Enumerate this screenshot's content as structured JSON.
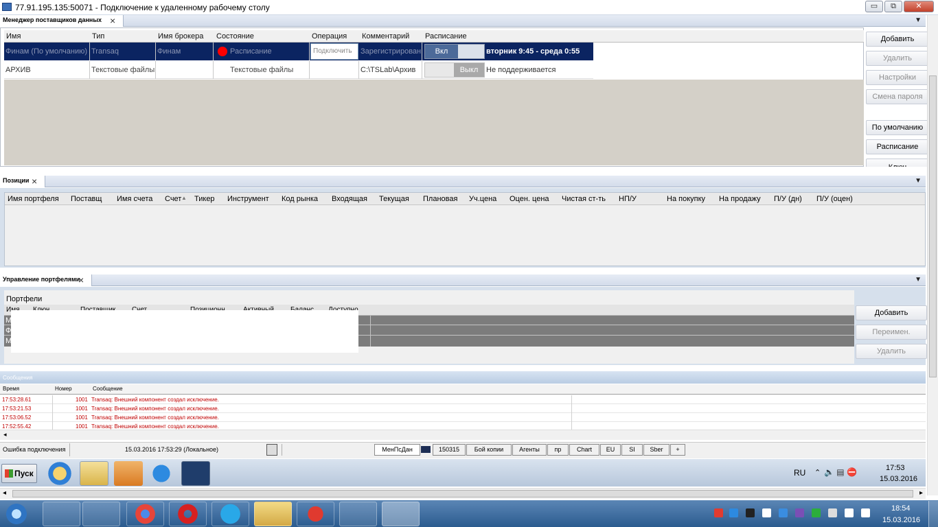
{
  "window": {
    "title": "77.91.195.135:50071 - Подключение к удаленному рабочему столу",
    "btn_min": "▭",
    "btn_restore": "⧉",
    "btn_close": "✕"
  },
  "providers": {
    "tab_label": "Менеджер поставщиков данных",
    "columns": [
      "Имя",
      "Тип",
      "Имя брокера",
      "Состояние",
      "Операция",
      "Комментарий",
      "Расписание"
    ],
    "rows": [
      {
        "name": "Финам (По умолчанию)",
        "type": "Transaq",
        "broker": "Финам",
        "state": "Расписание",
        "operation": "Подключить",
        "comment": "Зарегистрирован",
        "toggle": "Вкл",
        "schedule": "вторник 9:45 - среда 0:55"
      },
      {
        "name": "АРХИВ",
        "type": "Текстовые файлы",
        "broker": "",
        "state": "Текстовые файлы",
        "operation": "",
        "comment": "C:\\TSLab\\Архив",
        "toggle": "Выкл",
        "schedule": "Не поддерживается"
      }
    ],
    "buttons": [
      "Добавить",
      "Удалить",
      "Настройки",
      "Смена пароля",
      "По умолчанию",
      "Расписание",
      "Ключ"
    ]
  },
  "positions": {
    "tab_label": "Позиции",
    "columns": [
      "Имя портфеля",
      "Поставщ",
      "Имя счета",
      "Счет",
      "Тикер",
      "Инструмент",
      "Код рынка",
      "Входящая",
      "Текущая",
      "Плановая",
      "Уч.цена",
      "Оцен. цена",
      "Чистая ст-ть",
      "НП/У",
      "На покупку",
      "На продажу",
      "П/У (дн)",
      "П/У (оцен)"
    ]
  },
  "portfolios": {
    "tab_label": "Управление портфелями",
    "title": "Портфели",
    "columns": [
      "Имя",
      "Ключ",
      "Поставщик",
      "Счет",
      "Позиционн",
      "Активный",
      "Баланс",
      "Доступно"
    ],
    "row_initials": [
      "М",
      "Ф",
      "М"
    ],
    "buttons": [
      "Добавить",
      "Переимен.",
      "Удалить"
    ]
  },
  "messages": {
    "tab_label": "Сообщения",
    "columns": [
      "Время",
      "Номер",
      "Сообщение"
    ],
    "rows": [
      {
        "time": "17:53:28.61",
        "num": "1001",
        "msg": "Transaq: Внешний компонент создал исключение."
      },
      {
        "time": "17:53:21.53",
        "num": "1001",
        "msg": "Transaq: Внешний компонент создал исключение."
      },
      {
        "time": "17:53:06.52",
        "num": "1001",
        "msg": "Transaq: Внешний компонент создал исключение."
      },
      {
        "time": "17:52:55.42",
        "num": "1001",
        "msg": "Transaq: Внешний компонент создал исключение."
      }
    ]
  },
  "statusbar": {
    "status": "Ошибка подключения",
    "datetime": "15.03.2016 17:53:29 (Локальное)"
  },
  "workspace_tabs": [
    "МенПсДан",
    "150315",
    "Бой копии",
    "Агенты",
    "пр",
    "Chart",
    "EU",
    "SI",
    "Sber",
    "+"
  ],
  "remote_taskbar": {
    "start": "Пуск",
    "lang": "RU",
    "time": "17:53",
    "date": "15.03.2016"
  },
  "local_taskbar": {
    "time": "18:54",
    "date": "15.03.2016"
  },
  "colors": {
    "selection": "#0b2461",
    "error_text": "#c00000",
    "grey_area": "#d4d0c8"
  }
}
